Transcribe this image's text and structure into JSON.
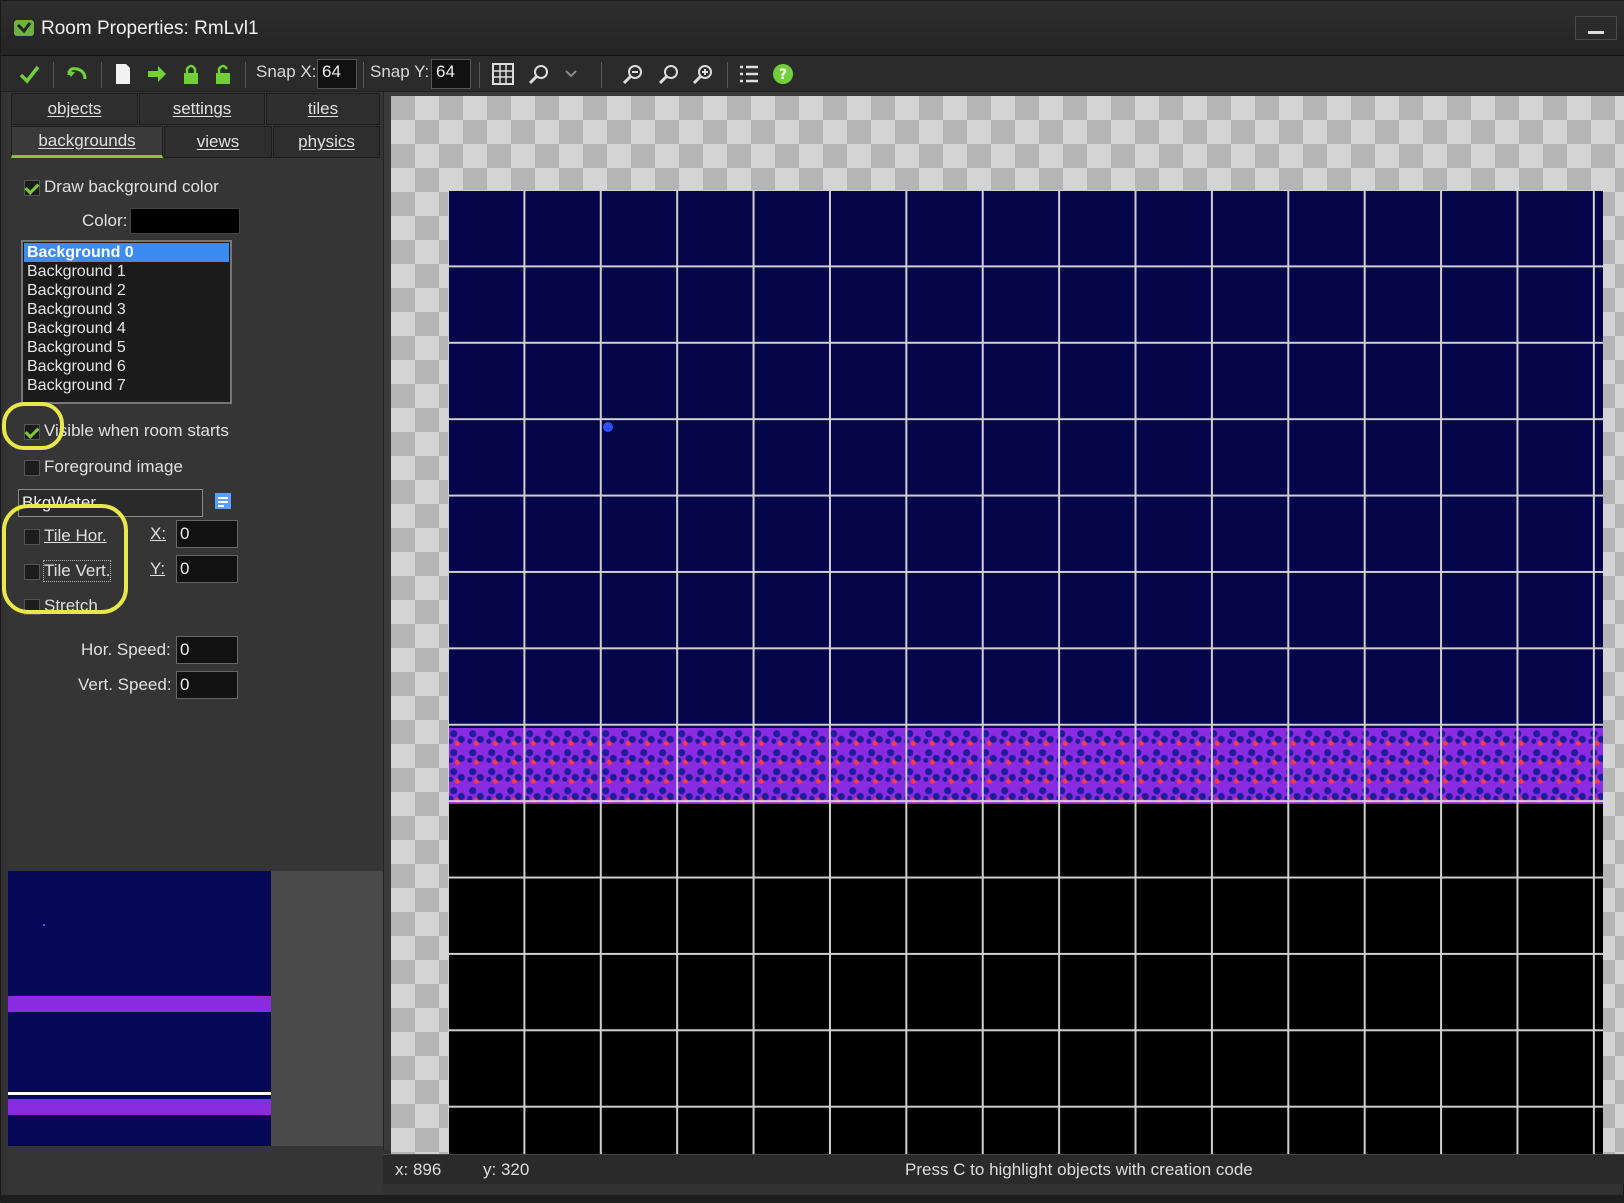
{
  "window": {
    "title": "Room Properties: RmLvl1"
  },
  "toolbar": {
    "snap_x_label": "Snap X:",
    "snap_x_value": "64",
    "snap_y_label": "Snap Y:",
    "snap_y_value": "64"
  },
  "tabs": {
    "row1": [
      "objects",
      "settings",
      "tiles"
    ],
    "row2": [
      "backgrounds",
      "views",
      "physics"
    ]
  },
  "backgrounds": {
    "draw_bg_color_label": "Draw background color",
    "color_label": "Color:",
    "color_value": "#000000",
    "list": [
      "Background 0",
      "Background 1",
      "Background 2",
      "Background 3",
      "Background 4",
      "Background 5",
      "Background 6",
      "Background 7"
    ],
    "selected_index": 0,
    "visible_label": "Visible when room starts",
    "foreground_label": "Foreground image",
    "bg_name": "BkgWater",
    "tile_hor_label": "Tile Hor.",
    "tile_vert_label": "Tile Vert.",
    "stretch_label": "Stretch",
    "x_label": "X:",
    "x_value": "0",
    "y_label": "Y:",
    "y_value": "0",
    "hor_speed_label": "Hor. Speed:",
    "hor_speed_value": "0",
    "vert_speed_label": "Vert. Speed:",
    "vert_speed_value": "0"
  },
  "status": {
    "x": "x: 896",
    "y": "y: 320",
    "hint": "Press C to highlight objects with creation code"
  },
  "colors": {
    "accent": "#7ec83a",
    "selection": "#3b8cf0",
    "room_bg": "#05054a",
    "tile": "#8a2be2",
    "highlight": "#e8e84a"
  }
}
